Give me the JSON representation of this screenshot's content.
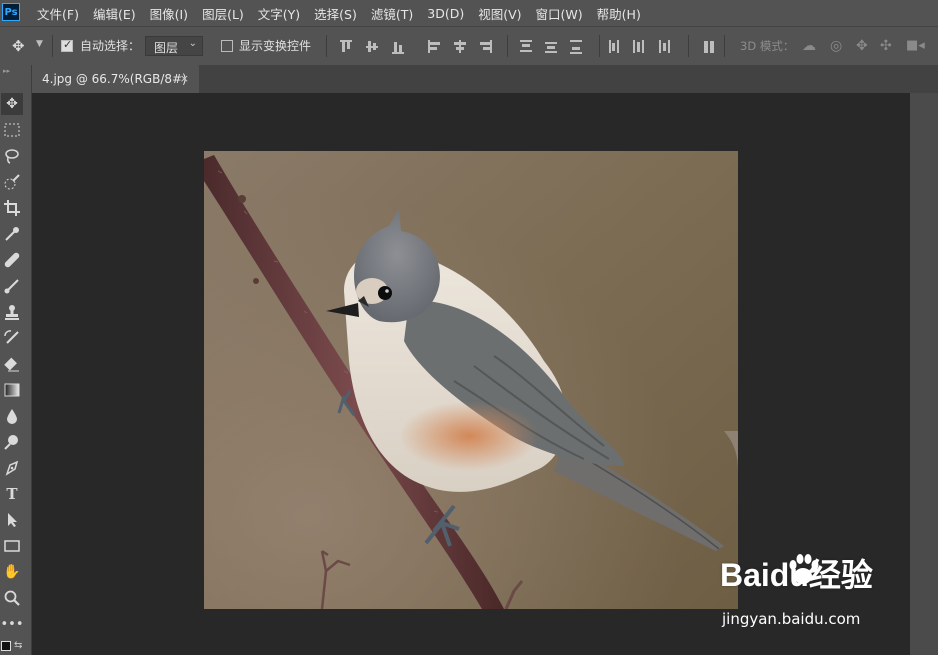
{
  "app": {
    "logo_text": "Ps"
  },
  "menu": [
    "文件(F)",
    "编辑(E)",
    "图像(I)",
    "图层(L)",
    "文字(Y)",
    "选择(S)",
    "滤镜(T)",
    "3D(D)",
    "视图(V)",
    "窗口(W)",
    "帮助(H)"
  ],
  "options": {
    "auto_select_label": "自动选择：",
    "auto_select_checked": true,
    "target_value": "图层",
    "show_transform_label": "显示变换控件",
    "show_transform_checked": false,
    "mode_3d_label": "3D 模式："
  },
  "document": {
    "tab_title": "4.jpg @ 66.7%(RGB/8#)",
    "close_glyph": "×"
  },
  "watermark": {
    "brand": "Baidu经验",
    "url": "jingyan.baidu.com"
  },
  "tools": [
    "move-tool",
    "marquee-tool",
    "lasso-tool",
    "quick-select-tool",
    "crop-tool",
    "eyedropper-tool",
    "healing-brush-tool",
    "brush-tool",
    "clone-stamp-tool",
    "history-brush-tool",
    "eraser-tool",
    "gradient-tool",
    "blur-tool",
    "dodge-tool",
    "pen-tool",
    "type-tool",
    "path-select-tool",
    "rectangle-tool",
    "hand-tool",
    "zoom-tool",
    "more-tools"
  ],
  "colors": {
    "panel": "#535353",
    "workspace": "#282828",
    "accent": "#31a8ff"
  }
}
